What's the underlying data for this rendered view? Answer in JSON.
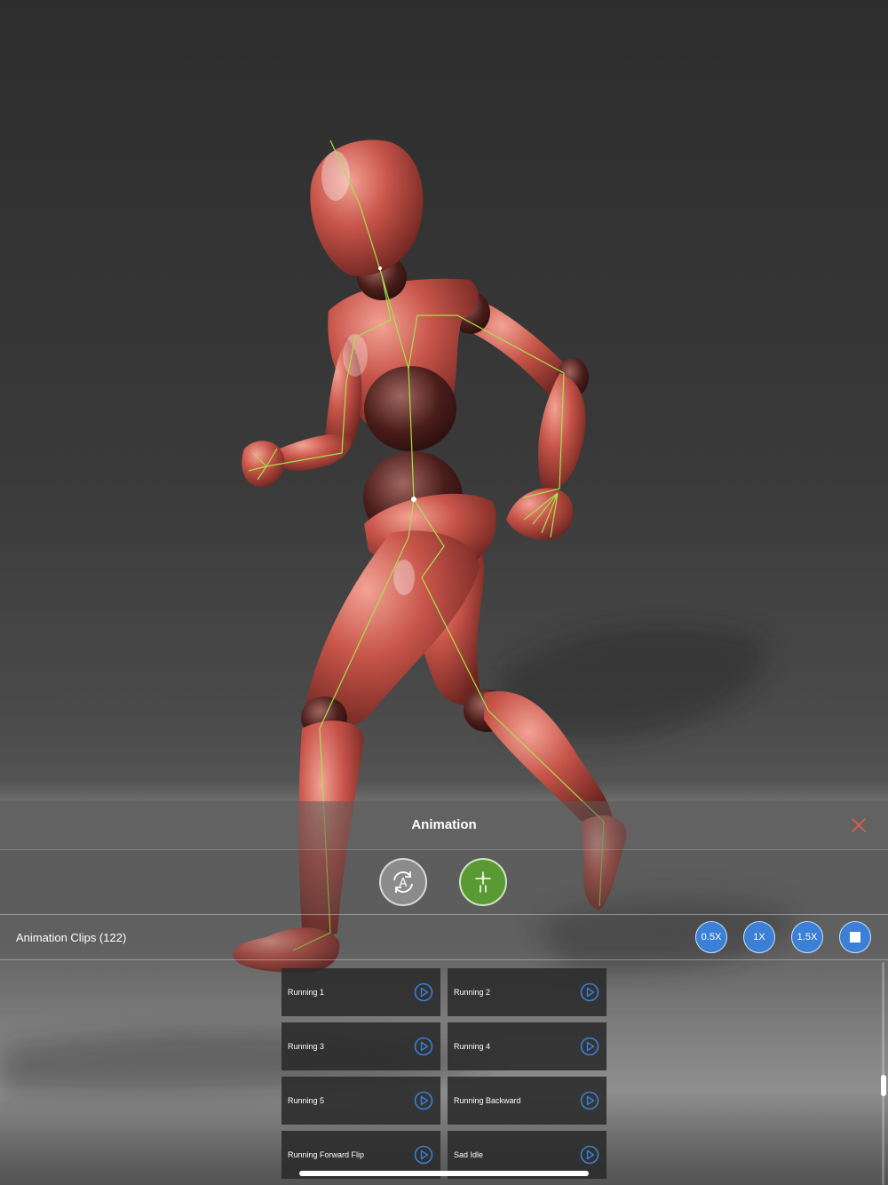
{
  "panel": {
    "title": "Animation"
  },
  "icons": {
    "close": "close-icon",
    "auto_rotate": "auto-rotate-icon",
    "skeleton": "skeleton-icon",
    "play": "play-icon",
    "stop": "stop-icon"
  },
  "clips": {
    "title": "Animation Clips (122)",
    "speeds": [
      "0.5X",
      "1X",
      "1.5X"
    ],
    "items": [
      {
        "label": "Running 1"
      },
      {
        "label": "Running 2"
      },
      {
        "label": "Running 3"
      },
      {
        "label": "Running 4"
      },
      {
        "label": "Running 5"
      },
      {
        "label": "Running Backward"
      },
      {
        "label": "Running Forward Flip"
      },
      {
        "label": "Sad Idle"
      }
    ]
  },
  "colors": {
    "accent_blue": "#3b7fd6",
    "skeleton_green": "#5a9a32",
    "close_red": "#e05a4a",
    "body_red": "#c8554a",
    "bone_line": "#a6e34a"
  }
}
